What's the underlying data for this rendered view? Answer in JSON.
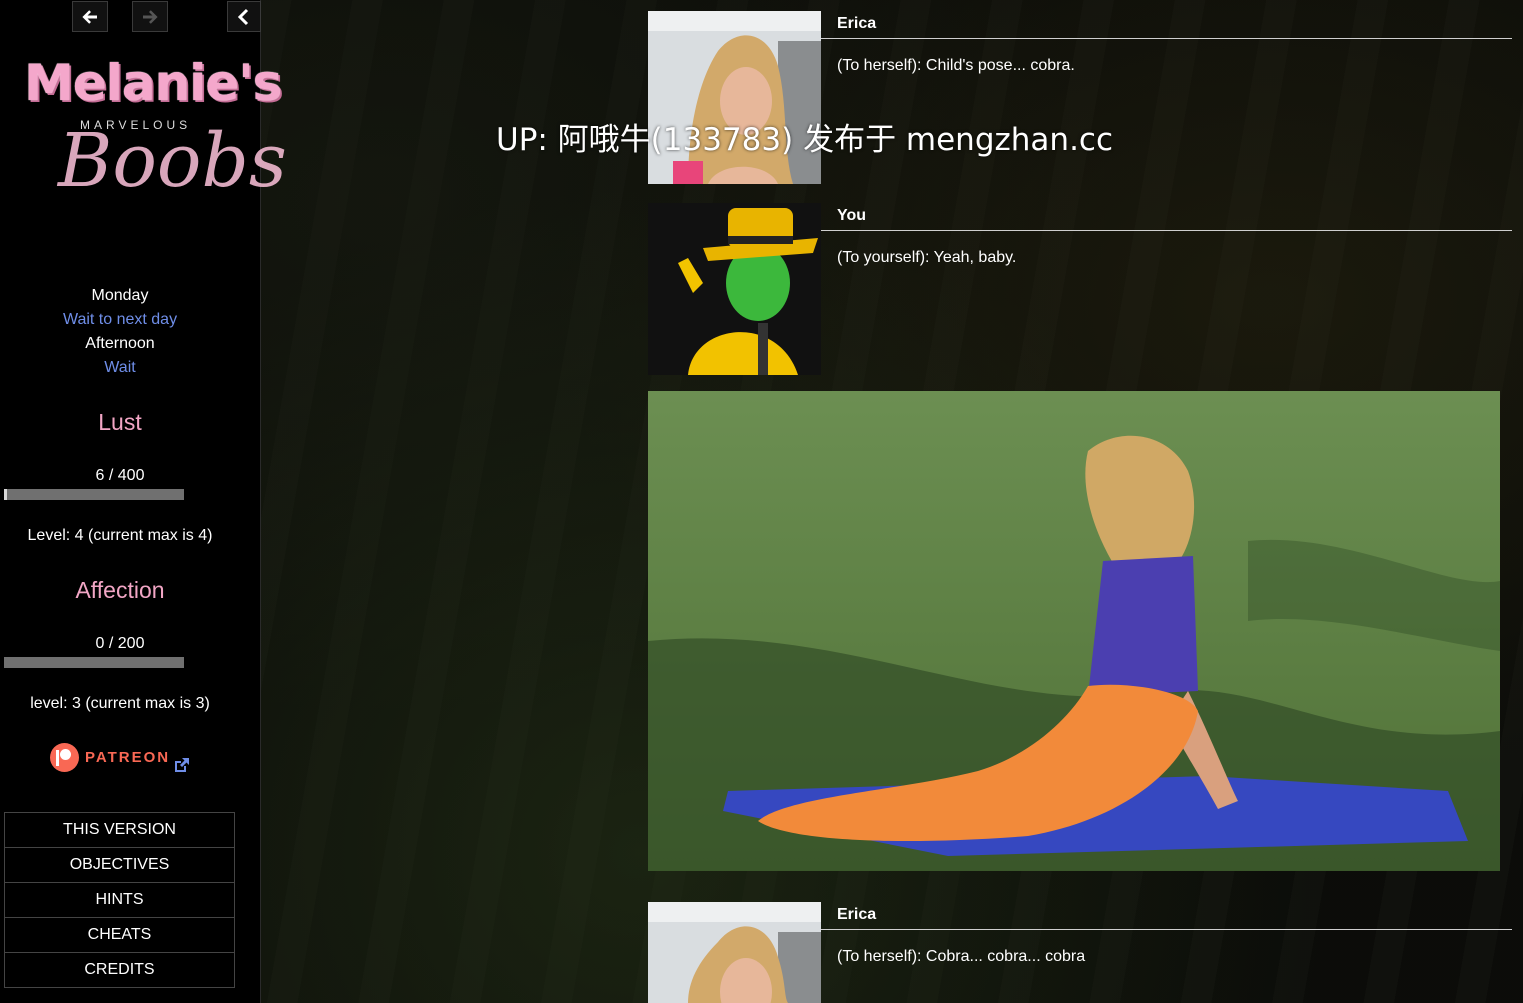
{
  "nav": {
    "back_icon": "arrow-left-icon",
    "forward_icon": "arrow-right-icon",
    "collapse_icon": "chevron-left-icon"
  },
  "logo": {
    "title": "Melanie's",
    "subtitle": "MARVELOUS",
    "script": "Boobs"
  },
  "time": {
    "day": "Monday",
    "wait_day_link": "Wait to next day",
    "period": "Afternoon",
    "wait_link": "Wait"
  },
  "stats": {
    "lust": {
      "title": "Lust",
      "value_text": "6 / 400",
      "current": 6,
      "max": 400,
      "level_text": "Level: 4 (current max is 4)"
    },
    "affection": {
      "title": "Affection",
      "value_text": "0 / 200",
      "current": 0,
      "max": 200,
      "level_text": "level: 3 (current max is 3)"
    }
  },
  "patreon": {
    "label": "PATREON",
    "color": "#f96854"
  },
  "menu": {
    "items": [
      "THIS VERSION",
      "OBJECTIVES",
      "HINTS",
      "CHEATS",
      "CREDITS"
    ]
  },
  "dialogue": [
    {
      "speaker": "Erica",
      "text": "(To herself): Child's pose... cobra."
    },
    {
      "speaker": "You",
      "text": "(To yourself): Yeah, baby."
    },
    {
      "speaker": "Erica",
      "text": "(To herself): Cobra... cobra... cobra"
    }
  ],
  "watermark": "UP: 阿哦牛(133783) 发布于 mengzhan.cc",
  "colors": {
    "link": "#6f8ee8",
    "stat_title": "#f2a6c5",
    "bar_track": "#707070",
    "bar_fill": "#d8d8d8"
  }
}
